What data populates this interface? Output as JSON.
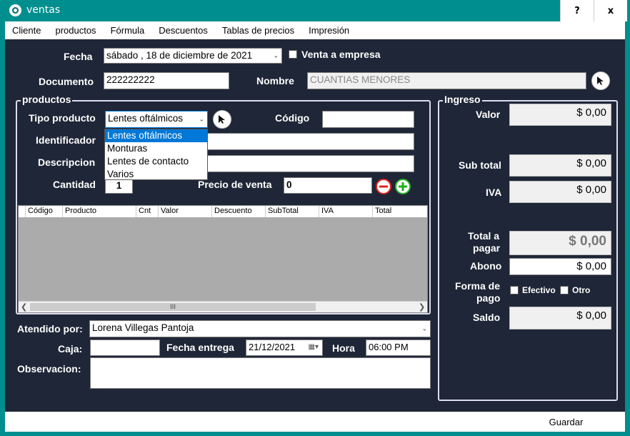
{
  "window": {
    "title": "ventas",
    "help_label": "?",
    "close_label": "x"
  },
  "menu": [
    "Cliente",
    "productos",
    "Fórmula",
    "Descuentos",
    "Tablas de precios",
    "Impresión"
  ],
  "header": {
    "fecha_label": "Fecha",
    "fecha_value": "sábado , 18 de diciembre de 2021",
    "venta_empresa_label": "Venta a empresa",
    "venta_empresa_checked": false,
    "documento_label": "Documento",
    "documento_value": "222222222",
    "nombre_label": "Nombre",
    "nombre_value": "CUANTIAS MENORES"
  },
  "productos": {
    "group_title": "productos",
    "tipo_label": "Tipo producto",
    "tipo_value": "Lentes oftálmicos",
    "tipo_options": [
      "Lentes oftálmicos",
      "Monturas",
      "Lentes de contacto",
      "Varios"
    ],
    "tipo_selected_index": 0,
    "codigo_label": "Código",
    "codigo_value": "",
    "identificador_label": "Identificador",
    "descripcion_label": "Descripcion",
    "cantidad_label": "Cantidad",
    "cantidad_value": "1",
    "precio_label": "Precio de venta",
    "precio_value": "0"
  },
  "grid": {
    "columns": [
      "Código",
      "Producto",
      "Cnt",
      "Valor",
      "Descuento",
      "SubTotal",
      "IVA",
      "Total"
    ],
    "rows": [],
    "scroll_thumb_glyph": "III"
  },
  "footer": {
    "atendido_label": "Atendido por:",
    "atendido_value": "Lorena Villegas Pantoja",
    "caja_label": "Caja:",
    "caja_value": "",
    "fecha_entrega_label": "Fecha entrega",
    "fecha_entrega_value": "21/12/2021",
    "hora_label": "Hora",
    "hora_value": "06:00 PM",
    "observacion_label": "Observacion:",
    "observacion_value": ""
  },
  "ingreso": {
    "group_title": "Ingreso",
    "valor_label": "Valor",
    "valor_value": "$ 0,00",
    "subtotal_label": "Sub total",
    "subtotal_value": "$ 0,00",
    "iva_label": "IVA",
    "iva_value": "$ 0,00",
    "total_label_1": "Total a",
    "total_label_2": "pagar",
    "total_value": "$ 0,00",
    "abono_label": "Abono",
    "abono_value": "$ 0,00",
    "forma_label_1": "Forma de",
    "forma_label_2": "pago",
    "efectivo_label": "Efectivo",
    "otro_label": "Otro",
    "saldo_label": "Saldo",
    "saldo_value": "$ 0,00"
  },
  "actions": {
    "guardar_label": "Guardar"
  },
  "colors": {
    "titlebar": "#008e8e",
    "panel": "#1f2637",
    "selection": "#0078d7",
    "remove": "#e02020",
    "add": "#20b020"
  }
}
